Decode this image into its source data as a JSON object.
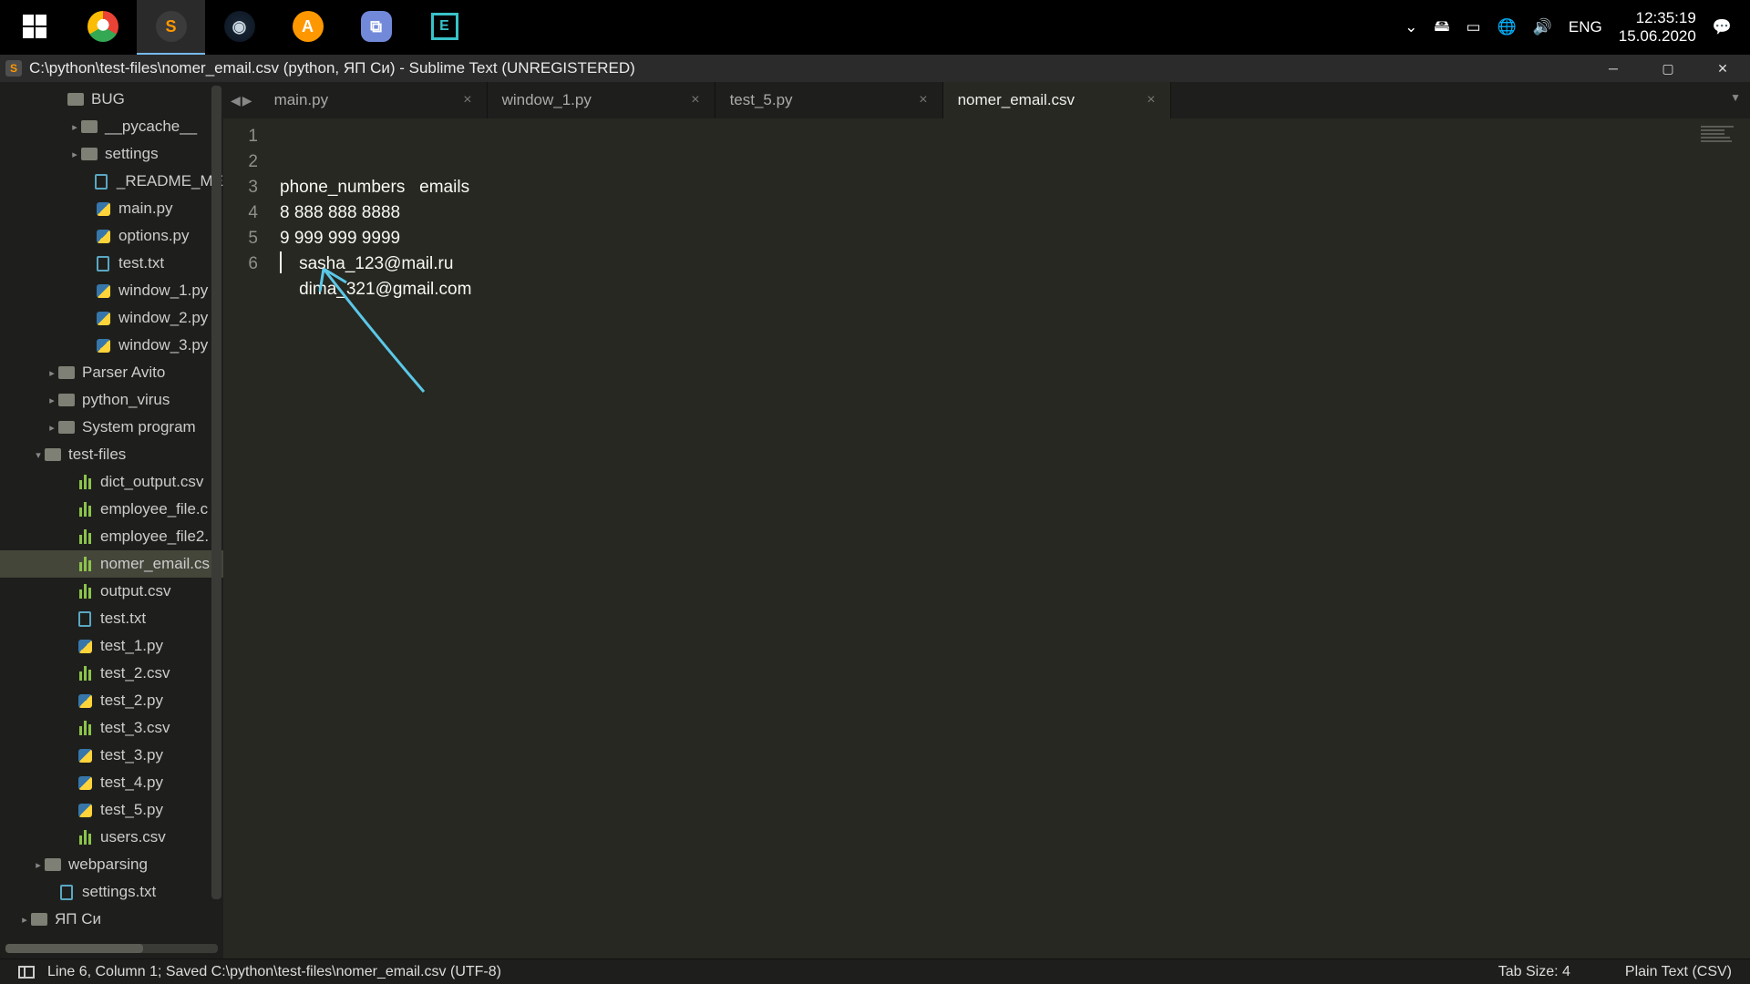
{
  "taskbar": {
    "clock_time": "12:35:19",
    "clock_date": "15.06.2020",
    "lang": "ENG"
  },
  "window": {
    "title": "C:\\python\\test-files\\nomer_email.csv (python, ЯП Си) - Sublime Text (UNREGISTERED)"
  },
  "tabs": [
    {
      "label": "main.py",
      "active": false
    },
    {
      "label": "window_1.py",
      "active": false
    },
    {
      "label": "test_5.py",
      "active": false
    },
    {
      "label": "nomer_email.csv",
      "active": true
    }
  ],
  "sidebar": {
    "items": [
      {
        "pad": 60,
        "arrow": "",
        "icon": "folder",
        "label": "BUG"
      },
      {
        "pad": 75,
        "arrow": "▸",
        "icon": "folder",
        "label": "__pycache__"
      },
      {
        "pad": 75,
        "arrow": "▸",
        "icon": "folder",
        "label": "settings"
      },
      {
        "pad": 90,
        "arrow": "",
        "icon": "txt",
        "label": "_README_ME"
      },
      {
        "pad": 90,
        "arrow": "",
        "icon": "py",
        "label": "main.py"
      },
      {
        "pad": 90,
        "arrow": "",
        "icon": "py",
        "label": "options.py"
      },
      {
        "pad": 90,
        "arrow": "",
        "icon": "txt",
        "label": "test.txt"
      },
      {
        "pad": 90,
        "arrow": "",
        "icon": "py",
        "label": "window_1.py"
      },
      {
        "pad": 90,
        "arrow": "",
        "icon": "py",
        "label": "window_2.py"
      },
      {
        "pad": 90,
        "arrow": "",
        "icon": "py",
        "label": "window_3.py"
      },
      {
        "pad": 50,
        "arrow": "▸",
        "icon": "folder",
        "label": "Parser Avito"
      },
      {
        "pad": 50,
        "arrow": "▸",
        "icon": "folder",
        "label": "python_virus"
      },
      {
        "pad": 50,
        "arrow": "▸",
        "icon": "folder",
        "label": "System program"
      },
      {
        "pad": 35,
        "arrow": "▾",
        "icon": "folder-open",
        "label": "test-files"
      },
      {
        "pad": 70,
        "arrow": "",
        "icon": "csv",
        "label": "dict_output.csv"
      },
      {
        "pad": 70,
        "arrow": "",
        "icon": "csv",
        "label": "employee_file.c"
      },
      {
        "pad": 70,
        "arrow": "",
        "icon": "csv",
        "label": "employee_file2."
      },
      {
        "pad": 70,
        "arrow": "",
        "icon": "csv",
        "label": "nomer_email.cs",
        "selected": true
      },
      {
        "pad": 70,
        "arrow": "",
        "icon": "csv",
        "label": "output.csv"
      },
      {
        "pad": 70,
        "arrow": "",
        "icon": "txt",
        "label": "test.txt"
      },
      {
        "pad": 70,
        "arrow": "",
        "icon": "py",
        "label": "test_1.py"
      },
      {
        "pad": 70,
        "arrow": "",
        "icon": "csv",
        "label": "test_2.csv"
      },
      {
        "pad": 70,
        "arrow": "",
        "icon": "py",
        "label": "test_2.py"
      },
      {
        "pad": 70,
        "arrow": "",
        "icon": "csv",
        "label": "test_3.csv"
      },
      {
        "pad": 70,
        "arrow": "",
        "icon": "py",
        "label": "test_3.py"
      },
      {
        "pad": 70,
        "arrow": "",
        "icon": "py",
        "label": "test_4.py"
      },
      {
        "pad": 70,
        "arrow": "",
        "icon": "py",
        "label": "test_5.py"
      },
      {
        "pad": 70,
        "arrow": "",
        "icon": "csv",
        "label": "users.csv"
      },
      {
        "pad": 35,
        "arrow": "▸",
        "icon": "folder",
        "label": "webparsing"
      },
      {
        "pad": 50,
        "arrow": "",
        "icon": "txt",
        "label": "settings.txt"
      },
      {
        "pad": 20,
        "arrow": "▸",
        "icon": "folder",
        "label": "ЯП Си"
      }
    ]
  },
  "editor": {
    "line_numbers": [
      "1",
      "2",
      "3",
      "4",
      "5",
      "6"
    ],
    "lines": [
      "phone_numbers   emails",
      "8 888 888 8888",
      "9 999 999 9999",
      "    sasha_123@mail.ru",
      "    dima_321@gmail.com",
      ""
    ]
  },
  "status": {
    "left": "Line 6, Column 1; Saved C:\\python\\test-files\\nomer_email.csv (UTF-8)",
    "tab_size": "Tab Size: 4",
    "syntax": "Plain Text (CSV)"
  }
}
